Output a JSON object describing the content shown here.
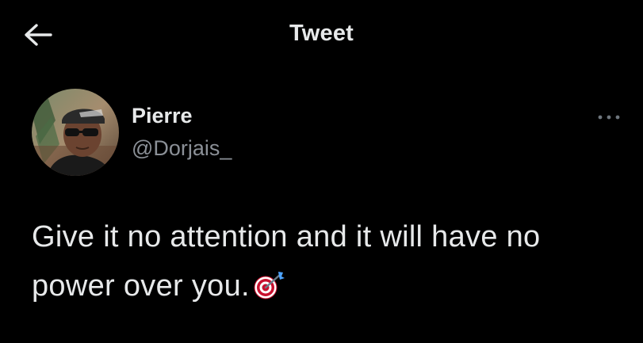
{
  "header": {
    "title": "Tweet",
    "back_icon": "arrow-left-icon"
  },
  "author": {
    "name": "Pierre",
    "handle": "@Dorjais_",
    "avatar_icon": "profile-photo",
    "more_icon": "more-horizontal-icon"
  },
  "tweet": {
    "text": "Give it no attention and it will have no power over you.",
    "emoji_icon": "direct-hit-target-icon"
  },
  "colors": {
    "background": "#000000",
    "primary_text": "#e7e9ea",
    "secondary_text": "#8b9097"
  }
}
